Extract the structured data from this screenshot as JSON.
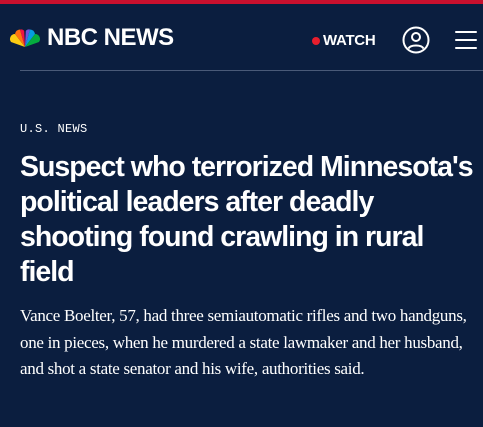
{
  "header": {
    "logo_text": "NBC NEWS",
    "watch_label": "WATCH",
    "live_dot_color": "#e81e2d",
    "accent_color": "#c8102e",
    "account_icon": "user-account-icon",
    "menu_icon": "hamburger-menu-icon"
  },
  "article": {
    "section": "U.S. NEWS",
    "headline": "Suspect who terrorized Minnesota's political leaders after deadly shooting found crawling in rural field",
    "dek": "Vance Boelter, 57, had three semiautomatic rifles and two handguns, one in pieces, when he murdered a state lawmaker and her husband, and shot a state senator and his wife, authorities said."
  }
}
